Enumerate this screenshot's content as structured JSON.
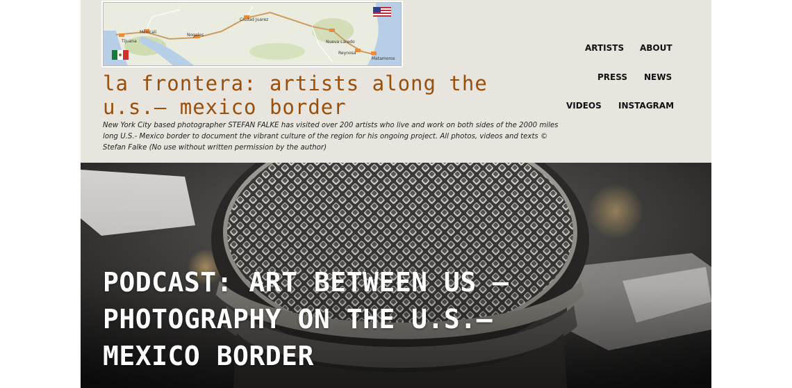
{
  "header": {
    "logo_map": {
      "labels": [
        "Tijuana",
        "Mexicali",
        "Nogales",
        "Ciudad Juarez",
        "Nueva Laredo",
        "Reynosa",
        "Matamoros"
      ]
    },
    "site_title": "la frontera: artists along the u.s.– mexico border",
    "description": "New York City based photographer STEFAN FALKE has visited over 200 artists who live and work on both sides of the 2000 miles long U.S.- Mexico border to document the vibrant culture of the region for his ongoing project. All photos, videos and texts © Stefan Falke (No use without written permission by the author)"
  },
  "nav": {
    "artists": "ARTISTS",
    "about": "ABOUT",
    "press": "PRESS",
    "news": "NEWS",
    "videos": "VIDEOS",
    "instagram": "INSTAGRAM"
  },
  "hero": {
    "title": "PODCAST: ART BETWEEN US – PHOTOGRAPHY ON THE U.S.– MEXICO BORDER",
    "image": "microphone-photo"
  },
  "colors": {
    "header_bg": "#e8e4de",
    "title_color": "#9a4f0a",
    "hero_text": "#ffffff"
  }
}
